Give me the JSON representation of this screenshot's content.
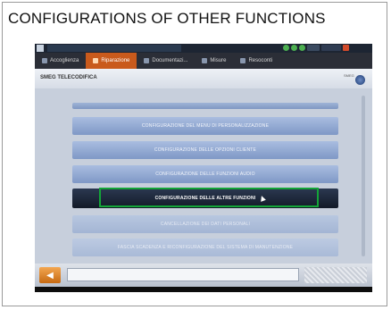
{
  "figure": {
    "title": "CONFIGURATIONS OF OTHER FUNCTIONS"
  },
  "app": {
    "tabs": [
      {
        "label": "Accoglienza",
        "icon": "home-icon",
        "active": false
      },
      {
        "label": "Riparazione",
        "icon": "wrench-icon",
        "active": true
      },
      {
        "label": "Documentazi...",
        "icon": "document-icon",
        "active": false
      },
      {
        "label": "Misure",
        "icon": "gauge-icon",
        "active": false
      },
      {
        "label": "Resoconti",
        "icon": "report-icon",
        "active": false
      }
    ],
    "header": {
      "label": "SMEG TELECODIFICA",
      "logo_text": "SMEG"
    },
    "menu": [
      {
        "label": ""
      },
      {
        "label": "CONFIGURAZIONE DEL MENU DI PERSONALIZZAZIONE"
      },
      {
        "label": "CONFIGURAZIONE DELLE OPZIONI CLIENTE"
      },
      {
        "label": "CONFIGURAZIONE DELLE FUNZIONI AUDIO"
      },
      {
        "label": "CONFIGURAZIONE DELLE ALTRE FUNZIONI",
        "selected": true
      },
      {
        "label": "CANCELLAZIONE DEI DATI PERSONALI"
      },
      {
        "label": "FASCIA SCADENZA E RICONFIGURAZIONE DEL SISTEMA DI MANUTENZIONE"
      }
    ],
    "highlight_color": "#13a538",
    "accent_color": "#c95a1c"
  }
}
